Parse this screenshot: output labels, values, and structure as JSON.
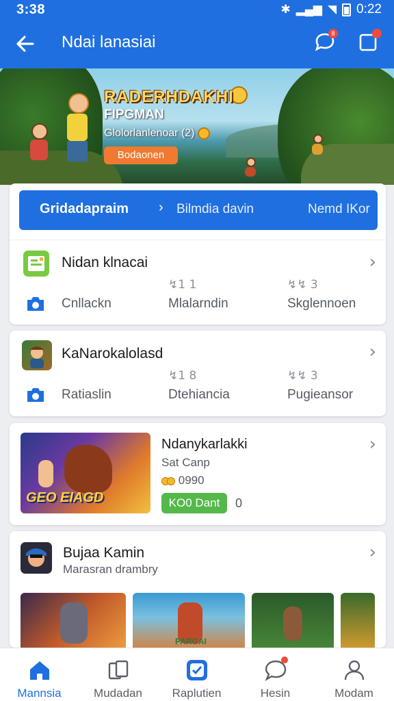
{
  "status_bar": {
    "time": "3:38",
    "right_time": "0:22"
  },
  "app_bar": {
    "title": "Ndai lanasiai",
    "chat_badge": "8"
  },
  "hero": {
    "title": "RADERHDAKHI",
    "subtitle": "FIPGMAN",
    "line": "Glolorlanlenoar (2)",
    "button": "Bodaonen"
  },
  "tabs": [
    "Gridadapraim",
    "Bilmdia davin",
    "Nemd IKor"
  ],
  "card1": {
    "title": "Nidan klnacai",
    "stats": [
      {
        "num": "",
        "label": "Cnllackn"
      },
      {
        "num": "↯1 1",
        "label": "Mlalarndin"
      },
      {
        "num": "↯↯ 3",
        "label": "Skglennoen"
      }
    ]
  },
  "card2": {
    "title": "KaNarokalolasd",
    "stats": [
      {
        "num": "",
        "label": "Ratiaslin"
      },
      {
        "num": "↯1 8",
        "label": "Dtehiancia"
      },
      {
        "num": "↯↯ 3",
        "label": "Pugieansor"
      }
    ]
  },
  "card3": {
    "title": "Ndanykarlakki",
    "subtitle": "Sat Canp",
    "coins": "0990",
    "button": "KO0 Dant",
    "count": "0",
    "thumb_text": "GEO EIAGD"
  },
  "card4": {
    "title": "Bujaa Kamin",
    "subtitle": "Marasran drambry",
    "thumb_text": "PARGAI"
  },
  "bottom_nav": [
    {
      "label": "Mannsia",
      "icon": "home-icon",
      "active": true
    },
    {
      "label": "Mudadan",
      "icon": "cards-icon",
      "active": false
    },
    {
      "label": "Raplutien",
      "icon": "check-app-icon",
      "active": false
    },
    {
      "label": "Hesin",
      "icon": "chat-icon",
      "active": false
    },
    {
      "label": "Modam",
      "icon": "profile-icon",
      "active": false
    }
  ],
  "colors": {
    "primary": "#1f6fe0",
    "green": "#54b84a",
    "orange": "#f07a30",
    "badge": "#f04a3c"
  }
}
